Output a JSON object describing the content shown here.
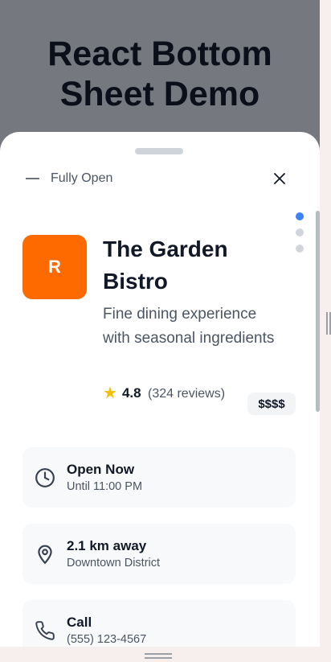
{
  "page": {
    "title": "React Bottom Sheet Demo"
  },
  "sheet": {
    "state_label": "Fully Open",
    "close_icon": "close-icon",
    "snap_points": [
      {
        "active": true
      },
      {
        "active": false
      },
      {
        "active": false
      }
    ]
  },
  "restaurant": {
    "avatar_letter": "R",
    "avatar_color": "#ff6a00",
    "name": "The Garden Bistro",
    "description": "Fine dining experience with seasonal ingredients",
    "rating": "4.8",
    "reviews": "(324 reviews)",
    "price": "$$$$"
  },
  "cards": [
    {
      "icon": "clock-icon",
      "title": "Open Now",
      "subtitle": "Until 11:00 PM"
    },
    {
      "icon": "location-pin-icon",
      "title": "2.1 km away",
      "subtitle": "Downtown District"
    },
    {
      "icon": "phone-icon",
      "title": "Call",
      "subtitle": "(555) 123-4567"
    }
  ],
  "colors": {
    "accent": "#3b82f6",
    "star": "#f5c000"
  }
}
